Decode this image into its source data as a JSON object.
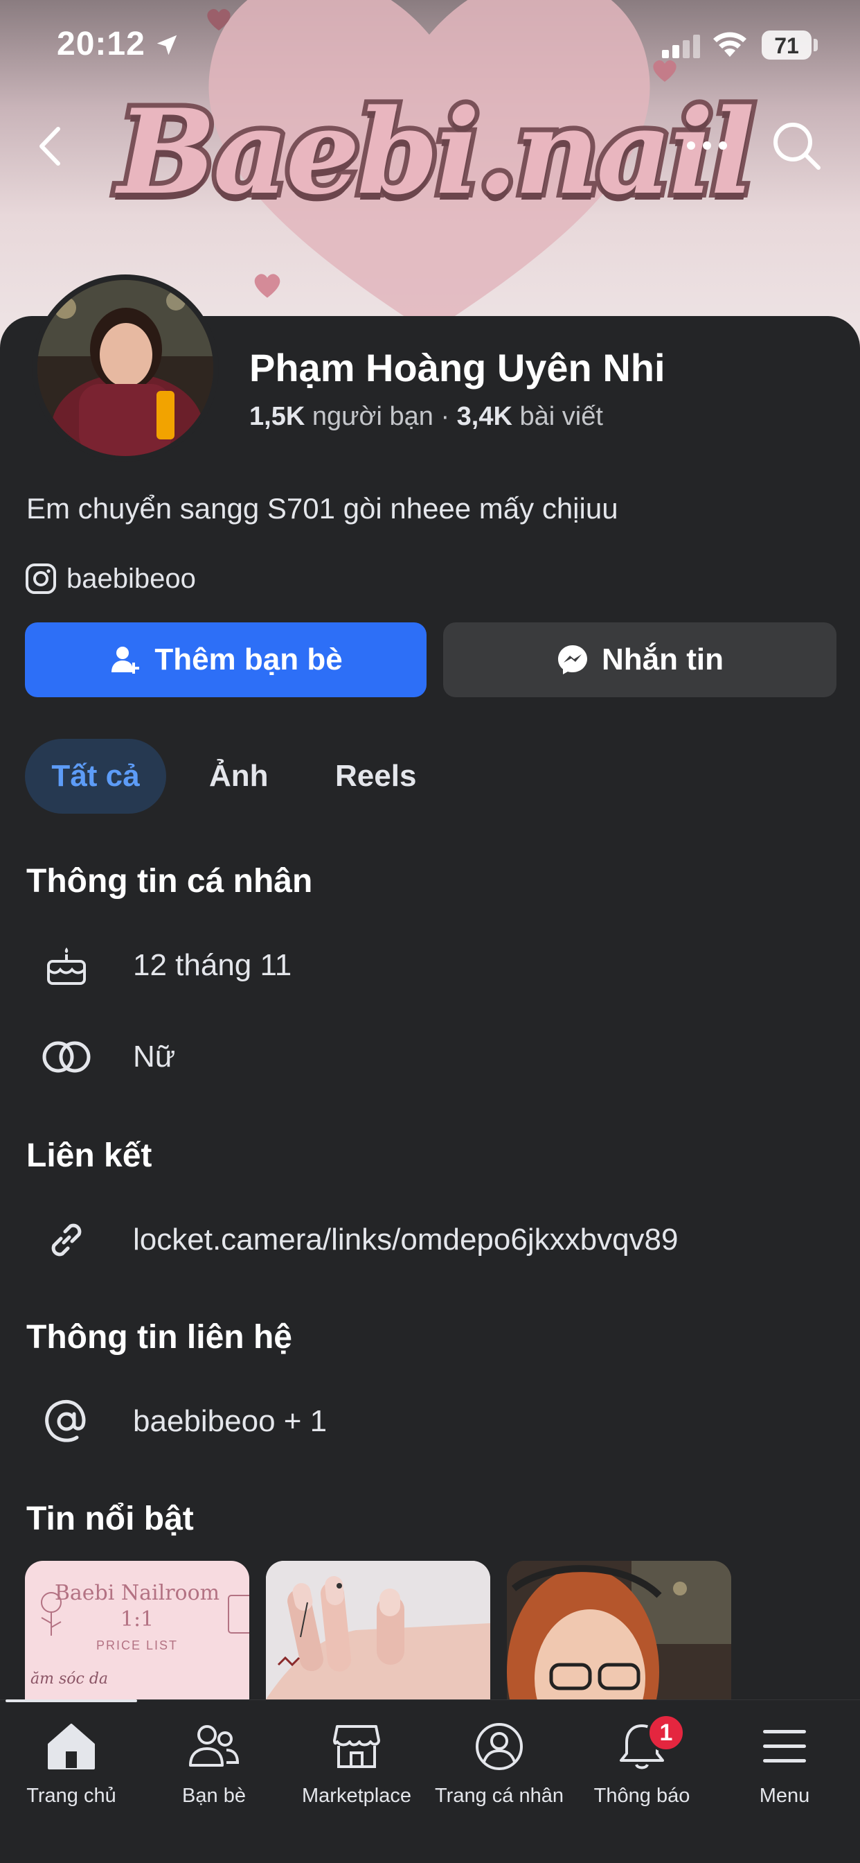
{
  "status_bar": {
    "time": "20:12",
    "battery": "71"
  },
  "cover": {
    "title": "Baebi.nail"
  },
  "profile": {
    "name": "Phạm Hoàng Uyên Nhi",
    "friends_count": "1,5K",
    "friends_label": "người bạn",
    "separator": "·",
    "posts_count": "3,4K",
    "posts_label": "bài viết",
    "bio": "Em chuyển sangg S701 gòi nheee mấy chịiuu",
    "instagram": "baebibeoo"
  },
  "actions": {
    "add_friend": "Thêm bạn bè",
    "message": "Nhắn tin"
  },
  "tabs": [
    {
      "label": "Tất cả",
      "active": true
    },
    {
      "label": "Ảnh",
      "active": false
    },
    {
      "label": "Reels",
      "active": false
    }
  ],
  "sections": {
    "personal_info": {
      "title": "Thông tin cá nhân",
      "birthday": "12 tháng 11",
      "gender": "Nữ"
    },
    "links": {
      "title": "Liên kết",
      "url": "locket.camera/links/omdepo6jkxxbvqv89"
    },
    "contact": {
      "title": "Thông tin liên hệ",
      "value": "baebibeoo + 1"
    },
    "highlights": {
      "title": "Tin nổi bật",
      "card1_title": "Baebi Nailroom\n1:1",
      "card1_sub": "PRICE LIST",
      "card1_text": "ăm sóc da"
    }
  },
  "bottom_nav": [
    {
      "label": "Trang chủ",
      "icon": "home-icon"
    },
    {
      "label": "Bạn bè",
      "icon": "friends-icon"
    },
    {
      "label": "Marketplace",
      "icon": "marketplace-icon"
    },
    {
      "label": "Trang cá nhân",
      "icon": "profile-icon"
    },
    {
      "label": "Thông báo",
      "icon": "bell-icon"
    },
    {
      "label": "Menu",
      "icon": "menu-icon"
    }
  ],
  "notification_badge": "1",
  "colors": {
    "background": "#242527",
    "primary": "#2d6ff7",
    "secondary_button": "#3a3b3d",
    "active_tab_bg": "#263951",
    "active_tab_text": "#5d9cf7",
    "badge": "#e4263f"
  }
}
